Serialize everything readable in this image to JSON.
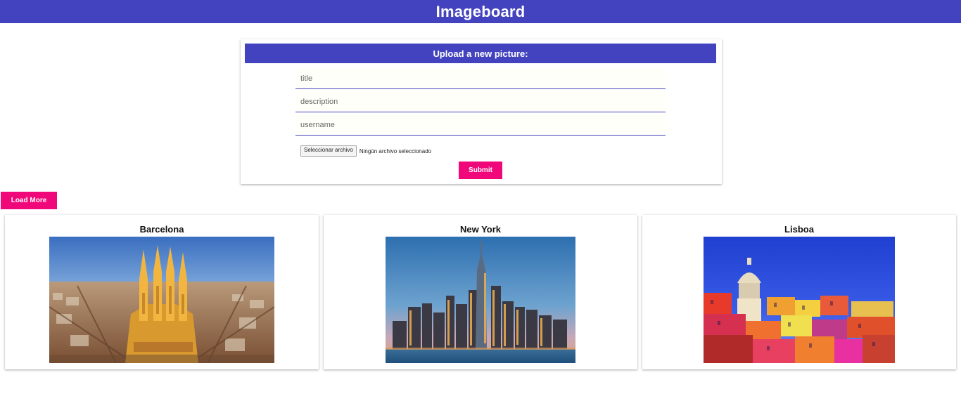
{
  "app": {
    "title": "Imageboard"
  },
  "upload_form": {
    "heading": "Upload a new picture:",
    "title_placeholder": "title",
    "description_placeholder": "description",
    "username_placeholder": "username",
    "file_button_label": "Seleccionar archivo",
    "file_status": "Ningún archivo seleccionado",
    "submit_label": "Submit"
  },
  "load_more_label": "Load More",
  "gallery": [
    {
      "title": "Barcelona",
      "image_icon": "sagrada-familia-photo"
    },
    {
      "title": "New York",
      "image_icon": "manhattan-skyline-photo"
    },
    {
      "title": "Lisboa",
      "image_icon": "lisbon-rooftops-photo"
    }
  ],
  "colors": {
    "primary": "#4343bf",
    "accent": "#f0077a",
    "background": "#ffffff"
  }
}
